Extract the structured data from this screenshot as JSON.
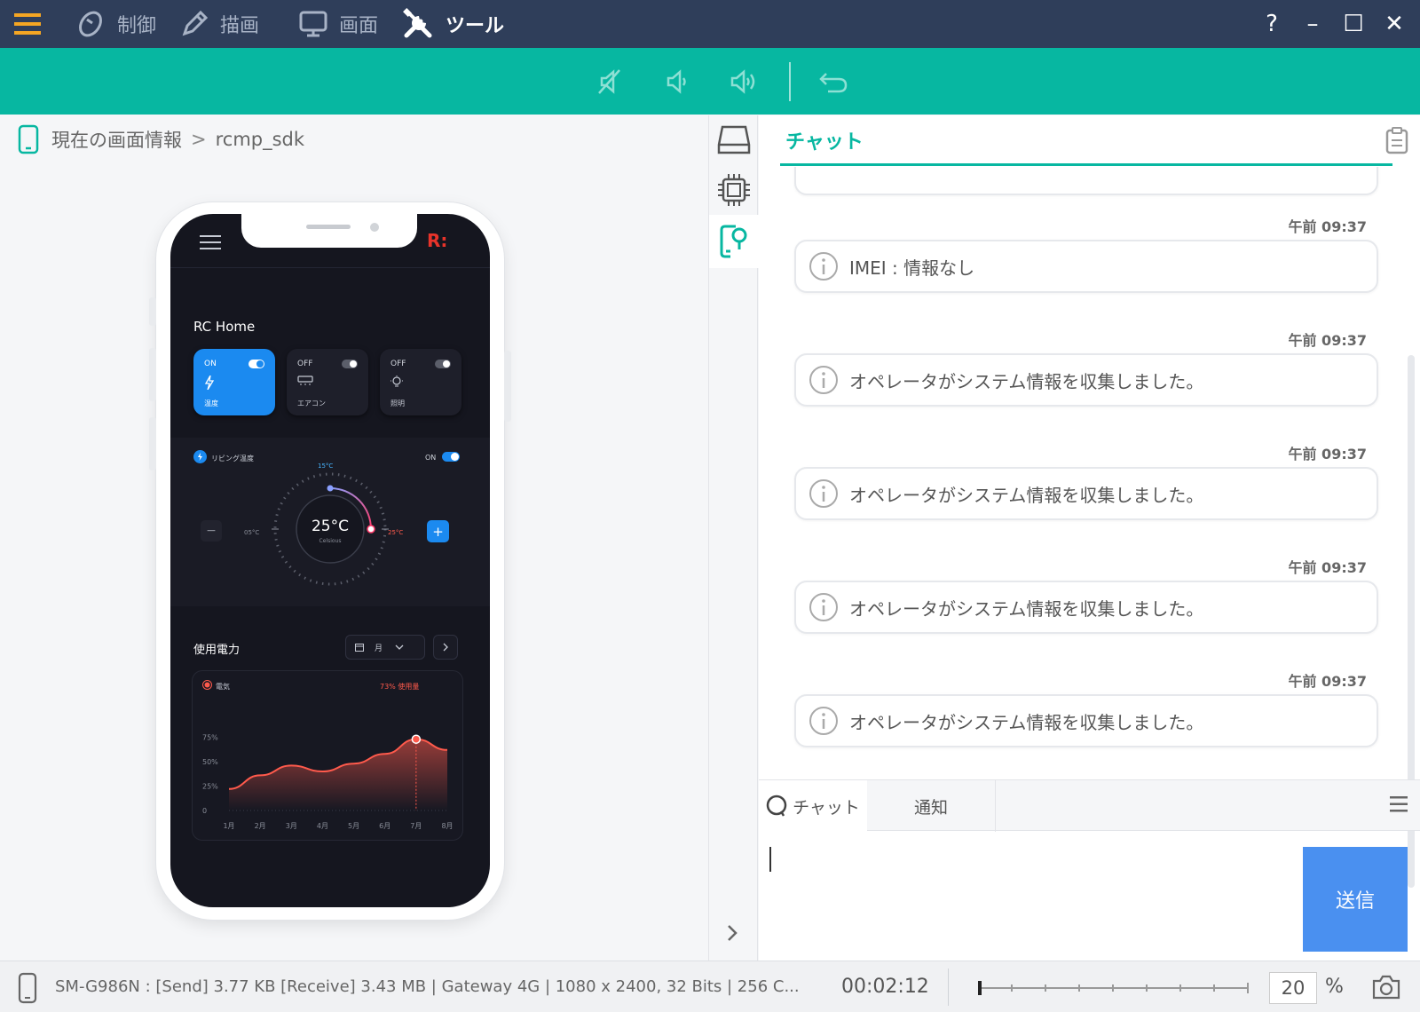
{
  "menu": {
    "items": [
      {
        "label": "制御",
        "icon": "mouse-icon"
      },
      {
        "label": "描画",
        "icon": "pencil-icon"
      },
      {
        "label": "画面",
        "icon": "monitor-icon"
      },
      {
        "label": "ツール",
        "icon": "tools-icon"
      }
    ],
    "help": "?",
    "minimize": "–",
    "maximize": "☐",
    "close": "✕"
  },
  "toolbar": {
    "buttons": [
      "mute-icon",
      "volume-down-icon",
      "volume-up-icon",
      "undo-icon"
    ]
  },
  "breadcrumb": {
    "root": "現在の画面情報",
    "separator": ">",
    "current": "rcmp_sdk"
  },
  "phone": {
    "app_title": "RC Home",
    "logo": "R:",
    "cards": [
      {
        "state": "ON",
        "label": "温度",
        "on": true
      },
      {
        "state": "OFF",
        "label": "エアコン",
        "on": false
      },
      {
        "state": "OFF",
        "label": "照明",
        "on": false
      }
    ],
    "thermo": {
      "label": "リビング温度",
      "toggle": "ON",
      "value": "25°C",
      "unit": "Celsious",
      "top": "15°C",
      "low": "05°C",
      "high": "25°C",
      "minus": "−",
      "plus": "+"
    },
    "power": {
      "title": "使用電力",
      "select": "月",
      "legend": "電気",
      "usage": "73% 使用量"
    }
  },
  "chart_data": {
    "type": "area",
    "x": [
      "1月",
      "2月",
      "3月",
      "4月",
      "5月",
      "6月",
      "7月",
      "8月"
    ],
    "y": [
      22,
      36,
      46,
      40,
      48,
      58,
      73,
      62
    ],
    "yticks": [
      "0",
      "25%",
      "50%",
      "75%"
    ],
    "ylim": [
      0,
      100
    ],
    "highlight": {
      "x": "7月",
      "y": 73
    },
    "grid": false
  },
  "side_icons": [
    "drive-icon",
    "chip-icon",
    "phone-info-icon"
  ],
  "chat": {
    "title": "チャット",
    "messages": [
      {
        "time": "午前 09:37",
        "text": "IMEI : 情報なし"
      },
      {
        "time": "午前 09:37",
        "text": "オペレータがシステム情報を収集しました。"
      },
      {
        "time": "午前 09:37",
        "text": "オペレータがシステム情報を収集しました。"
      },
      {
        "time": "午前 09:37",
        "text": "オペレータがシステム情報を収集しました。"
      },
      {
        "time": "午前 09:37",
        "text": "オペレータがシステム情報を収集しました。"
      }
    ],
    "tabs": {
      "chat": "チャット",
      "notice": "通知"
    },
    "input_value": "",
    "send": "送信"
  },
  "status": {
    "device": "SM-G986N : [Send] 3.77 KB   [Receive] 3.43 MB | Gateway 4G | 1080 x 2400, 32 Bits | 256 C...",
    "time": "00:02:12",
    "zoom": "20",
    "zoom_unit": "%",
    "zoom_level": 0.0
  },
  "colors": {
    "topbar": "#2f3e5a",
    "toolbar": "#07b7a1",
    "accent": "#07b7a1",
    "send": "#4a90f0",
    "phone_accent": "#1b8af0",
    "chart": "#ff5a4c"
  }
}
